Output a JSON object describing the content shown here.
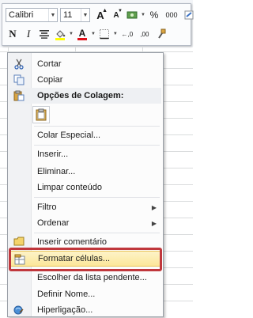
{
  "toolbar": {
    "font_name": "Calibri",
    "font_size": "11",
    "grow_font_label": "A",
    "shrink_font_label": "A",
    "currency_label": "€",
    "percent_label": "%",
    "thousands_label": "000",
    "bold_label": "N",
    "italic_label": "I",
    "font_color_label": "A",
    "inc_decimal_label": "←,0",
    "dec_decimal_label": ",00",
    "fill_color": "#ffff00",
    "font_color": "#e0101a"
  },
  "menu": {
    "items": [
      {
        "label": "Cortar",
        "icon": "scissors-icon"
      },
      {
        "label": "Copiar",
        "icon": "copy-icon"
      },
      {
        "label": "Opções de Colagem:",
        "icon": "paste-options-icon"
      },
      {
        "label": "Colar Especial...",
        "icon": ""
      },
      {
        "label": "Inserir...",
        "icon": ""
      },
      {
        "label": "Eliminar...",
        "icon": ""
      },
      {
        "label": "Limpar conteúdo",
        "icon": ""
      },
      {
        "label": "Filtro",
        "icon": "",
        "submenu": true
      },
      {
        "label": "Ordenar",
        "icon": "",
        "submenu": true
      },
      {
        "label": "Inserir comentário",
        "icon": "comment-icon"
      },
      {
        "label": "Formatar células...",
        "icon": "format-cells-icon"
      },
      {
        "label": "Escolher da lista pendente...",
        "icon": ""
      },
      {
        "label": "Definir Nome...",
        "icon": ""
      },
      {
        "label": "Hiperligação...",
        "icon": "hyperlink-icon"
      }
    ]
  }
}
